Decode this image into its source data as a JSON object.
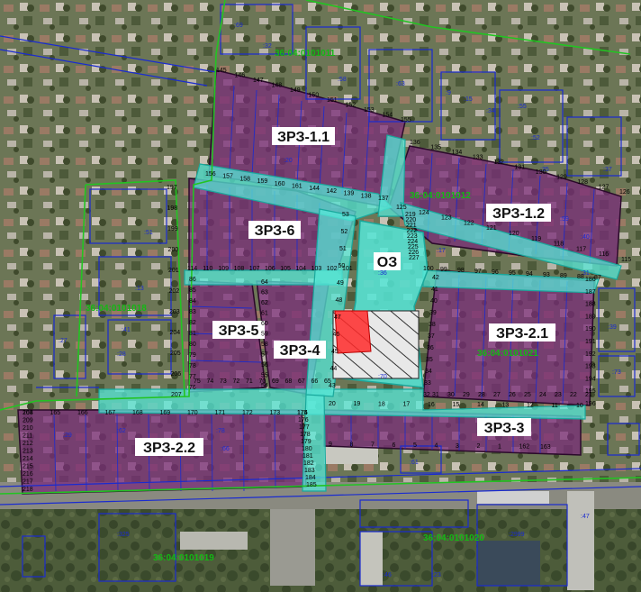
{
  "zones": [
    {
      "id": "zrz-1-1",
      "label": "ЗРЗ-1.1"
    },
    {
      "id": "zrz-1-2",
      "label": "ЗРЗ-1.2"
    },
    {
      "id": "zrz-6",
      "label": "ЗРЗ-6"
    },
    {
      "id": "oz",
      "label": "ОЗ"
    },
    {
      "id": "zrz-5",
      "label": "ЗРЗ-5"
    },
    {
      "id": "zrz-4",
      "label": "ЗРЗ-4"
    },
    {
      "id": "zrz-2-1",
      "label": "ЗРЗ-2.1"
    },
    {
      "id": "zrz-3",
      "label": "ЗРЗ-3"
    },
    {
      "id": "zrz-2-2",
      "label": "ЗРЗ-2.2"
    }
  ],
  "cadastral_quarters": [
    {
      "id": "q1",
      "label": "36:04:0101011"
    },
    {
      "id": "q2",
      "label": "36:04:0101012"
    },
    {
      "id": "q3",
      "label": "36:04:0101018"
    },
    {
      "id": "q4",
      "label": "36:04:0101021"
    },
    {
      "id": "q5",
      "label": "36:04:0101020"
    },
    {
      "id": "q6",
      "label": "36:04:0101019"
    }
  ],
  "parcel_ids": [
    ":32",
    ":9",
    ":15",
    ":20",
    ":27",
    ":34",
    ":52",
    ":37",
    ":35",
    ":59",
    ":40",
    ":39",
    ":51",
    ":13",
    ":28",
    ":41",
    ":78",
    ":62",
    ":31",
    ":66",
    ":61",
    ":55",
    ":29",
    ":23",
    ":46",
    ":325",
    ":2999",
    ":17",
    ":36",
    ":47",
    ":58",
    ":63",
    ":69",
    ":70",
    ":73"
  ],
  "lot_numbers": [
    "145",
    "146",
    "147",
    "148",
    "149",
    "150",
    "151",
    "152",
    "153",
    "154",
    "155",
    "156",
    "157",
    "158",
    "159",
    "160",
    "161",
    "144",
    "142",
    "139",
    "138",
    "137",
    "136",
    "135",
    "134",
    "133",
    "132",
    "131",
    "130",
    "129",
    "128",
    "127",
    "126",
    "125",
    "124",
    "123",
    "122",
    "121",
    "120",
    "119",
    "118",
    "117",
    "116",
    "115",
    "114",
    "110",
    "109",
    "108",
    "107",
    "106",
    "105",
    "104",
    "103",
    "102",
    "101",
    "100",
    "99",
    "98",
    "97",
    "96",
    "95",
    "94",
    "93",
    "89",
    "88",
    "87",
    "86",
    "85",
    "84",
    "83",
    "82",
    "81",
    "80",
    "79",
    "78",
    "77",
    "76",
    "75",
    "74",
    "73",
    "72",
    "71",
    "70",
    "69",
    "68",
    "67",
    "66",
    "65",
    "64",
    "63",
    "62",
    "61",
    "60",
    "59",
    "58",
    "57",
    "56",
    "55",
    "54",
    "53",
    "52",
    "51",
    "50",
    "49",
    "48",
    "47",
    "46",
    "45",
    "44",
    "43",
    "42",
    "41",
    "40",
    "39",
    "38",
    "37",
    "36",
    "35",
    "34",
    "33",
    "32",
    "31",
    "30",
    "29",
    "28",
    "27",
    "26",
    "25",
    "24",
    "23",
    "22",
    "21",
    "20",
    "19",
    "18",
    "17",
    "16",
    "15",
    "14",
    "13",
    "12",
    "11",
    "10",
    "9",
    "8",
    "7",
    "6",
    "5",
    "4",
    "3",
    "2",
    "1",
    "162",
    "163",
    "164",
    "165",
    "166",
    "167",
    "168",
    "169",
    "170",
    "171",
    "172",
    "173",
    "174",
    "175",
    "176",
    "177",
    "178",
    "179",
    "180",
    "181",
    "182",
    "183",
    "184",
    "185",
    "186",
    "187",
    "188",
    "189",
    "190",
    "191",
    "192",
    "193",
    "194",
    "195",
    "196",
    "197",
    "198",
    "199",
    "200",
    "201",
    "202",
    "203",
    "204",
    "205",
    "206",
    "207",
    "208",
    "209",
    "210",
    "211",
    "212",
    "213",
    "214",
    "215",
    "216",
    "217",
    "218",
    "219",
    "220",
    "221",
    "222",
    "223",
    "224",
    "225",
    "226",
    "227"
  ],
  "colors": {
    "zone_fill": "#7a2a7a",
    "zone_stroke": "#2b0a2b",
    "road_fill": "#55e8d8",
    "road_stroke": "#1aa89c",
    "parcel_stroke": "#1a2bd0",
    "quarter_stroke": "#22c422",
    "hatch_stroke": "#222222",
    "red_zone": "#ff2a2a"
  }
}
